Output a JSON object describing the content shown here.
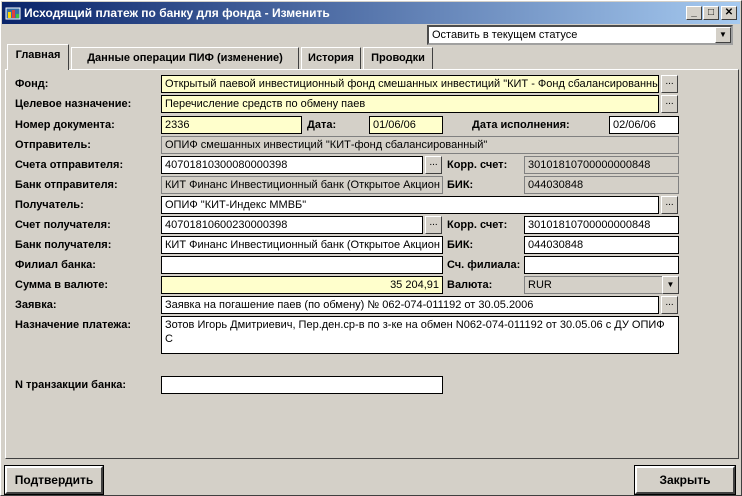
{
  "window": {
    "title": "Исходящий платеж по банку для фонда - Изменить"
  },
  "status_combo": {
    "value": "Оставить в текущем статусе"
  },
  "tabs": [
    {
      "label": "Главная"
    },
    {
      "label": "Данные операции ПИФ (изменение)"
    },
    {
      "label": "История"
    },
    {
      "label": "Проводки"
    }
  ],
  "form": {
    "fond": {
      "label": "Фонд:",
      "value": "Открытый паевой инвестиционный фонд смешанных инвестиций \"КИТ - Фонд сбалансированны"
    },
    "purpose": {
      "label": "Целевое назначение:",
      "value": "Перечисление средств по обмену паев"
    },
    "doc_number": {
      "label": "Номер документа:",
      "value": "2336"
    },
    "date": {
      "label": "Дата:",
      "value": "01/06/06"
    },
    "exec_date": {
      "label": "Дата исполнения:",
      "value": "02/06/06"
    },
    "sender": {
      "label": "Отправитель:",
      "value": "ОПИФ смешанных инвестиций \"КИТ-фонд  сбалансированный\""
    },
    "sender_account": {
      "label": "Счета отправителя:",
      "value": "40701810300080000398"
    },
    "sender_corr": {
      "label": "Корр. счет:",
      "value": "30101810700000000848"
    },
    "sender_bank": {
      "label": "Банк отправителя:",
      "value": "КИТ Финанс Инвестиционный банк (Открытое Акцион"
    },
    "sender_bik": {
      "label": "БИК:",
      "value": "044030848"
    },
    "recipient": {
      "label": "Получатель:",
      "value": "ОПИФ \"КИТ-Индекс ММВБ\""
    },
    "recipient_account": {
      "label": "Счет получателя:",
      "value": "40701810600230000398"
    },
    "recipient_corr": {
      "label": "Корр. счет:",
      "value": "30101810700000000848"
    },
    "recipient_bank": {
      "label": "Банк получателя:",
      "value": "КИТ Финанс Инвестиционный банк (Открытое Акцион"
    },
    "recipient_bik": {
      "label": "БИК:",
      "value": "044030848"
    },
    "branch": {
      "label": "Филиал банка:",
      "value": ""
    },
    "branch_account": {
      "label": "Сч. филиала:",
      "value": ""
    },
    "amount": {
      "label": "Сумма в валюте:",
      "value": "35 204,91"
    },
    "currency": {
      "label": "Валюта:",
      "value": "RUR"
    },
    "request": {
      "label": "Заявка:",
      "value": "Заявка на погашение паев (по обмену) № 062-074-011192 от 30.05.2006"
    },
    "payment_purpose": {
      "label": "Назначение платежа:",
      "value": "Зотов Игорь Дмитриевич, Пер.ден.ср-в по з-ке на обмен N062-074-011192 от 30.05.06 с ДУ ОПИФ С"
    },
    "transaction": {
      "label": "N транзакции банка:",
      "value": ""
    }
  },
  "buttons": {
    "confirm": "Подтвердить",
    "close": "Закрыть"
  },
  "ellipsis": "...",
  "icons": {
    "title_buttons": [
      "minimize-icon",
      "maximize-icon",
      "close-icon"
    ]
  }
}
